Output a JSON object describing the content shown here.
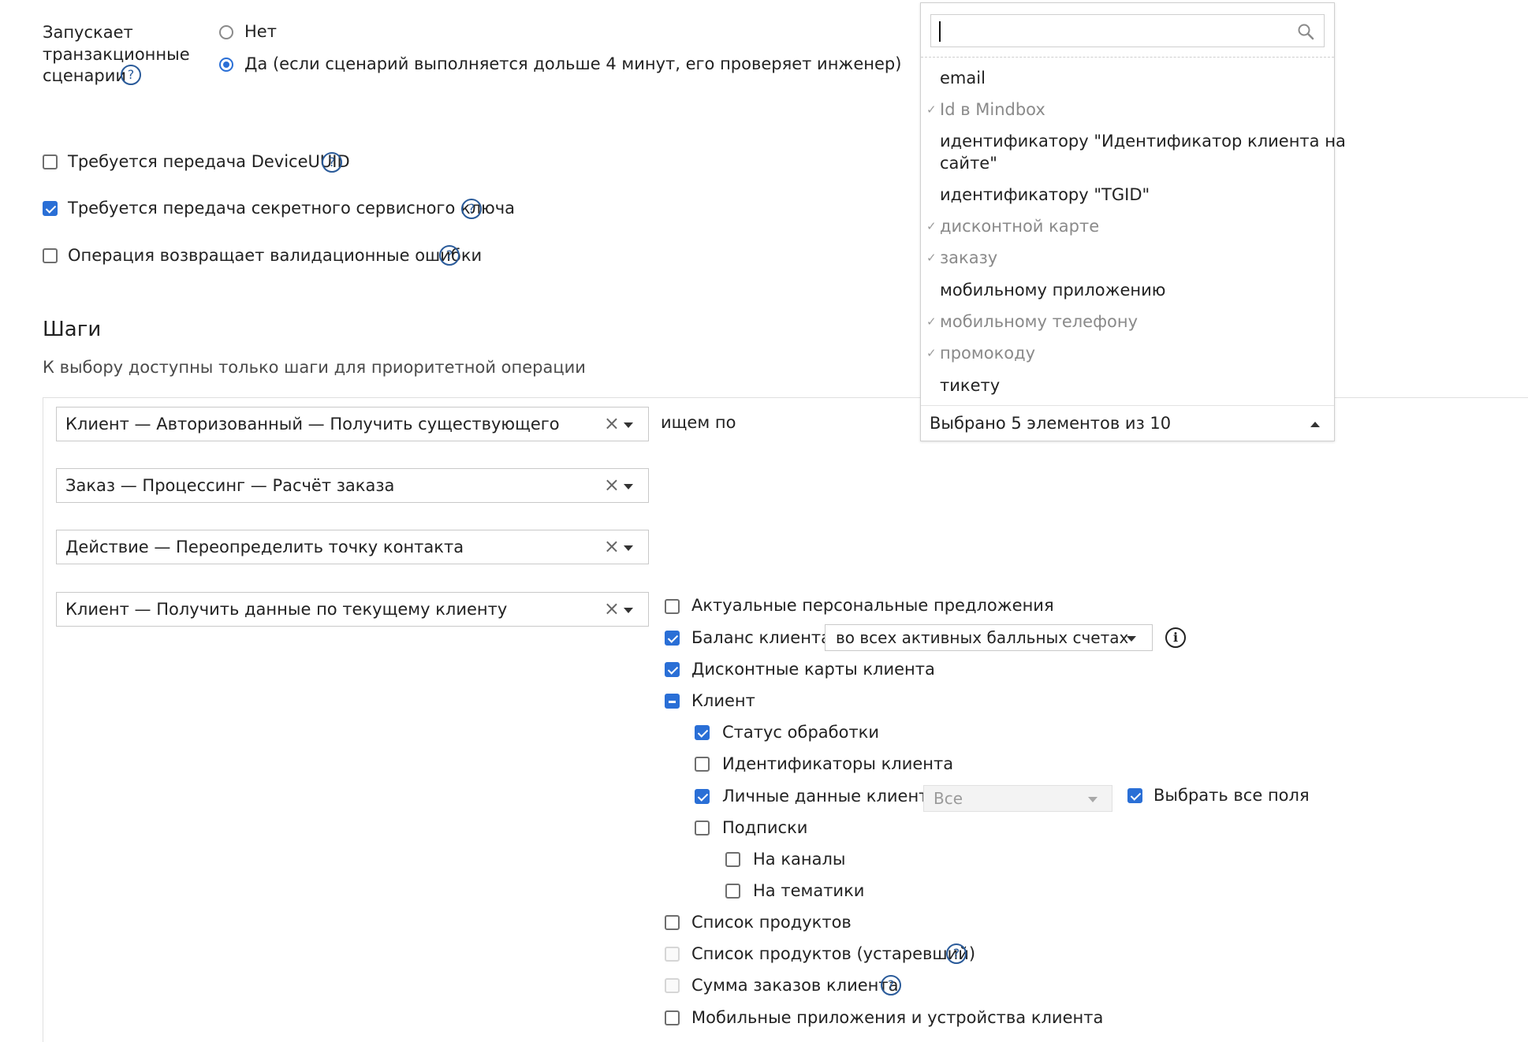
{
  "transactional": {
    "label_line1": "Запускает",
    "label_line2": "транзакционные",
    "label_line3": "сценарии",
    "option_no": "Нет",
    "option_yes": "Да (если сценарий выполняется дольше 4 минут, его проверяет инженер)",
    "selected": "yes"
  },
  "options": {
    "device_uuid": {
      "label": "Требуется передача DeviceUUID",
      "checked": false
    },
    "secret_key": {
      "label": "Требуется передача секретного сервисного ключа",
      "checked": true
    },
    "validation_errors": {
      "label": "Операция возвращает валидационные ошибки",
      "checked": false
    }
  },
  "steps": {
    "title": "Шаги",
    "subtitle": "К выбору доступны только шаги для приоритетной операции",
    "items": [
      {
        "label": "Клиент — Авторизованный — Получить существующего"
      },
      {
        "label": "Заказ — Процессинг — Расчёт заказа"
      },
      {
        "label": "Действие — Переопределить точку контакта"
      },
      {
        "label": "Клиент — Получить данные по текущему клиенту"
      }
    ],
    "search_by_label": "ищем по"
  },
  "dropdown": {
    "search_value": "",
    "items": [
      {
        "label": "email",
        "selected": false
      },
      {
        "label": "Id в Mindbox",
        "selected": true
      },
      {
        "label_line1": "идентификатору \"Идентификатор клиента на",
        "label_line2": "сайте\"",
        "selected": false
      },
      {
        "label": "идентификатору \"TGID\"",
        "selected": false
      },
      {
        "label": "дисконтной карте",
        "selected": true
      },
      {
        "label": "заказу",
        "selected": true
      },
      {
        "label": "мобильному приложению",
        "selected": false
      },
      {
        "label": "мобильному телефону",
        "selected": true
      },
      {
        "label": "промокоду",
        "selected": true
      },
      {
        "label": "тикету",
        "selected": false
      }
    ],
    "summary": "Выбрано 5 элементов из 10"
  },
  "client_data": {
    "personal_offers": {
      "label": "Актуальные персональные предложения",
      "checked": false
    },
    "balance": {
      "label": "Баланс клиента",
      "checked": true,
      "select_value": "во всех активных балльных счетах"
    },
    "discount_cards": {
      "label": "Дисконтные карты клиента",
      "checked": true
    },
    "client": {
      "label": "Клиент",
      "state": "indeterminate"
    },
    "processing_status": {
      "label": "Статус обработки",
      "checked": true
    },
    "client_ids": {
      "label": "Идентификаторы клиента",
      "checked": false
    },
    "personal_data": {
      "label": "Личные данные клиента",
      "checked": true,
      "select_value": "Все",
      "select_all_label": "Выбрать все поля",
      "select_all_checked": true
    },
    "subscriptions": {
      "label": "Подписки",
      "checked": false
    },
    "channels": {
      "label": "На каналы",
      "checked": false
    },
    "topics": {
      "label": "На тематики",
      "checked": false
    },
    "products": {
      "label": "Список продуктов",
      "checked": false
    },
    "products_legacy": {
      "label": "Список продуктов (устаревший)",
      "checked": false,
      "disabled": true
    },
    "orders_sum": {
      "label": "Сумма заказов клиента",
      "checked": false,
      "disabled": true
    },
    "mobile_apps": {
      "label": "Мобильные приложения и устройства клиента",
      "checked": false
    }
  },
  "icons": {
    "help": "?",
    "info": "i",
    "clear": "×",
    "check": "✓"
  },
  "colors": {
    "accent": "#2a6fd6",
    "help": "#2a5b9a",
    "muted": "#8a8a8a"
  }
}
